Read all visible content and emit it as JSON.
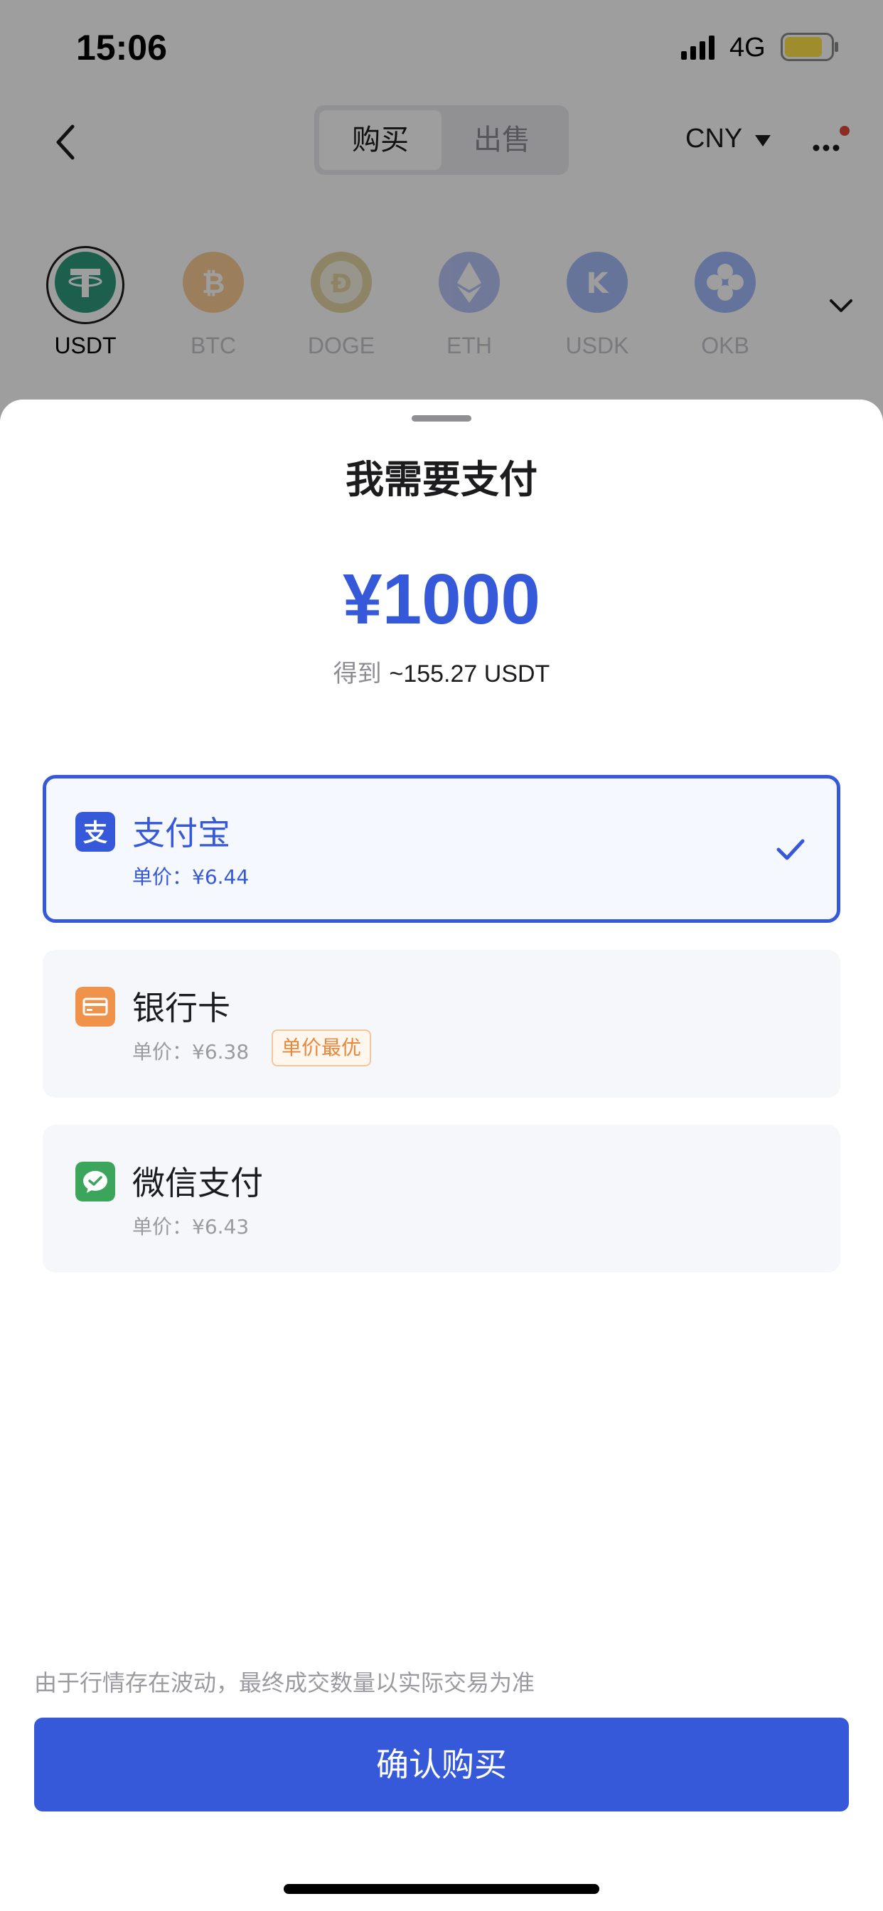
{
  "status_bar": {
    "time": "15:06",
    "network": "4G"
  },
  "nav": {
    "tabs": [
      {
        "label": "购买",
        "active": true
      },
      {
        "label": "出售",
        "active": false
      }
    ],
    "currency": "CNY"
  },
  "coins": [
    {
      "symbol": "USDT",
      "color": "#2f9a7c",
      "active": true
    },
    {
      "symbol": "BTC",
      "color": "#f7931a",
      "active": false
    },
    {
      "symbol": "DOGE",
      "color": "#c2a633",
      "active": false
    },
    {
      "symbol": "ETH",
      "color": "#627eea",
      "active": false
    },
    {
      "symbol": "USDK",
      "color": "#3d6cf0",
      "active": false
    },
    {
      "symbol": "OKB",
      "color": "#2e67f6",
      "active": false
    }
  ],
  "sheet": {
    "title": "我需要支付",
    "amount": "¥1000",
    "receive_prefix": "得到",
    "receive_value": "~155.27 USDT",
    "payment_methods": [
      {
        "name": "支付宝",
        "price_label": "单价：",
        "price": "¥6.44",
        "selected": true,
        "icon": "alipay-icon",
        "color": "#3559d8"
      },
      {
        "name": "银行卡",
        "price_label": "单价：",
        "price": "¥6.38",
        "badge": "单价最优",
        "selected": false,
        "icon": "bank-card-icon",
        "color": "#f0934a"
      },
      {
        "name": "微信支付",
        "price_label": "单价：",
        "price": "¥6.43",
        "selected": false,
        "icon": "wechat-pay-icon",
        "color": "#3ba55c"
      }
    ],
    "disclaimer": "由于行情存在波动，最终成交数量以实际交易为准",
    "confirm_label": "确认购买"
  },
  "colors": {
    "accent": "#3559d8",
    "best_badge": "#e6893f"
  }
}
